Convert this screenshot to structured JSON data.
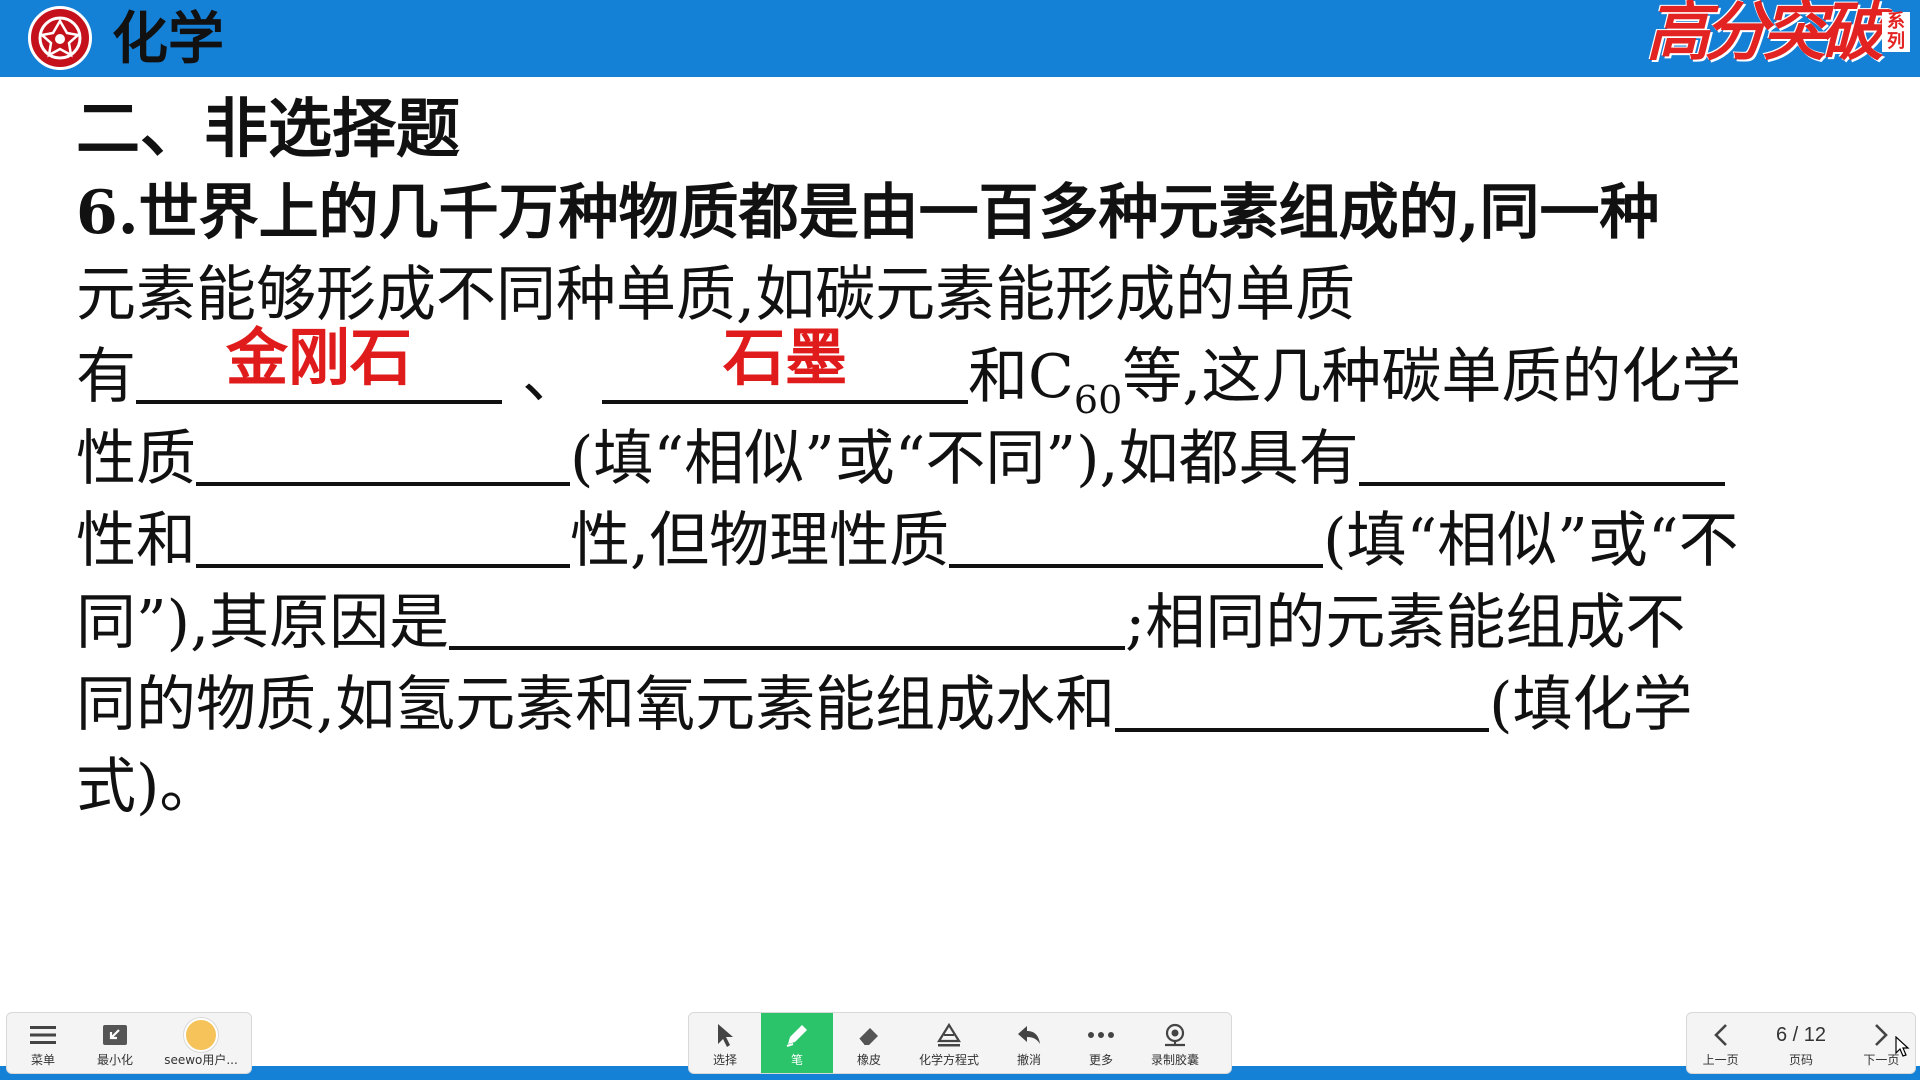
{
  "header": {
    "subject": "化学",
    "brand_main": "高分突破",
    "brand_sub": "系列"
  },
  "content": {
    "section_title": "二、非选择题",
    "q_line1": "6.世界上的几千万种物质都是由一百多种元素组成的,同一种",
    "q_line2": "元素能够形成不同种单质,如碳元素能形成的单质",
    "q_line3_a": "有",
    "answer1": "金刚石",
    "q_line3_sep": "、",
    "answer2": "石墨",
    "q_line3_b": "和C",
    "q_line3_sub": "60",
    "q_line3_c": "等,这几种碳单质的化学",
    "q_line4_a": "性质",
    "q_line4_b": "(填“相似”或“不同”),如都具有",
    "q_line5_a": "性和",
    "q_line5_b": "性,但物理性质",
    "q_line5_c": "(填“相似”或“不",
    "q_line6_a": "同”),其原因是",
    "q_line6_b": ";相同的元素能组成不",
    "q_line7_a": "同的物质,如氢元素和氧元素能组成水和",
    "q_line7_b": "(填化学",
    "q_line8": "式)。"
  },
  "toolbar": {
    "left": [
      {
        "label": "菜单",
        "icon": "menu-icon"
      },
      {
        "label": "最小化",
        "icon": "minimize-icon"
      },
      {
        "label": "seewo用户...",
        "icon": "avatar-icon"
      }
    ],
    "center": [
      {
        "label": "选择",
        "icon": "cursor-icon"
      },
      {
        "label": "笔",
        "icon": "pen-icon",
        "active": true
      },
      {
        "label": "橡皮",
        "icon": "eraser-icon"
      },
      {
        "label": "化学方程式",
        "icon": "flask-icon"
      },
      {
        "label": "撤消",
        "icon": "undo-icon"
      },
      {
        "label": "更多",
        "icon": "more-icon"
      },
      {
        "label": "录制胶囊",
        "icon": "record-icon"
      }
    ],
    "right": {
      "prev_label": "上一页",
      "page_text": "6 / 12",
      "page_label": "页码",
      "next_label": "下一页"
    },
    "accent": "#2bc46a"
  }
}
